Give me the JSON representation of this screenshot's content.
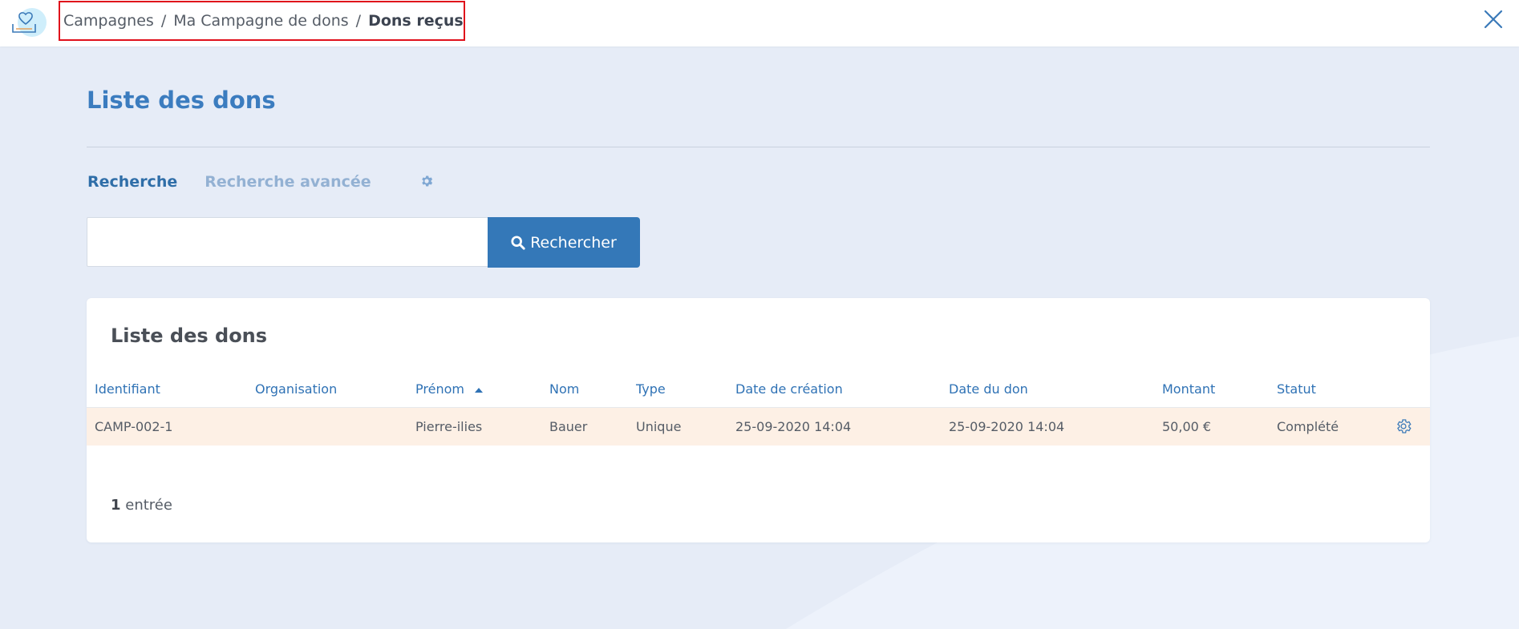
{
  "breadcrumb": {
    "items": [
      "Campagnes",
      "Ma Campagne de dons"
    ],
    "separator": "/",
    "current": "Dons reçus"
  },
  "page": {
    "title": "Liste des dons"
  },
  "tabs": {
    "search": "Recherche",
    "advanced": "Recherche avancée"
  },
  "search": {
    "value": "",
    "button_label": "Rechercher"
  },
  "list": {
    "title": "Liste des dons",
    "columns": [
      "Identifiant",
      "Organisation",
      "Prénom",
      "Nom",
      "Type",
      "Date de création",
      "Date du don",
      "Montant",
      "Statut"
    ],
    "sorted_column": "Prénom",
    "rows": [
      {
        "id": "CAMP-002-1",
        "organisation": "",
        "prenom": "Pierre-ilies",
        "nom": "Bauer",
        "type": "Unique",
        "date_creation": "25-09-2020 14:04",
        "date_don": "25-09-2020 14:04",
        "montant": "50,00 €",
        "statut": "Complété"
      }
    ],
    "count": "1",
    "count_label": "entrée"
  },
  "icons": {
    "logo": "heart-hand-icon",
    "close": "close-icon",
    "settings": "gear-icon",
    "search": "search-icon",
    "sort": "sort-asc-icon"
  },
  "colors": {
    "accent": "#3478b8",
    "title": "#3b7cbf",
    "header_text": "#2f72b5",
    "row_highlight": "#fdf0e5",
    "background": "#e6ecf7",
    "breadcrumb_highlight_border": "#e0101b"
  }
}
